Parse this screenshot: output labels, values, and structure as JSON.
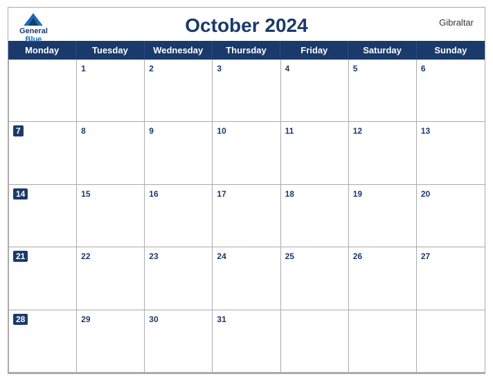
{
  "header": {
    "title": "October 2024",
    "location": "Gibraltar",
    "logo_general": "General",
    "logo_blue": "Blue"
  },
  "days": [
    "Monday",
    "Tuesday",
    "Wednesday",
    "Thursday",
    "Friday",
    "Saturday",
    "Sunday"
  ],
  "weeks": [
    [
      null,
      1,
      2,
      3,
      4,
      5,
      6
    ],
    [
      7,
      8,
      9,
      10,
      11,
      12,
      13
    ],
    [
      14,
      15,
      16,
      17,
      18,
      19,
      20
    ],
    [
      21,
      22,
      23,
      24,
      25,
      26,
      27
    ],
    [
      28,
      29,
      30,
      31,
      null,
      null,
      null
    ]
  ]
}
